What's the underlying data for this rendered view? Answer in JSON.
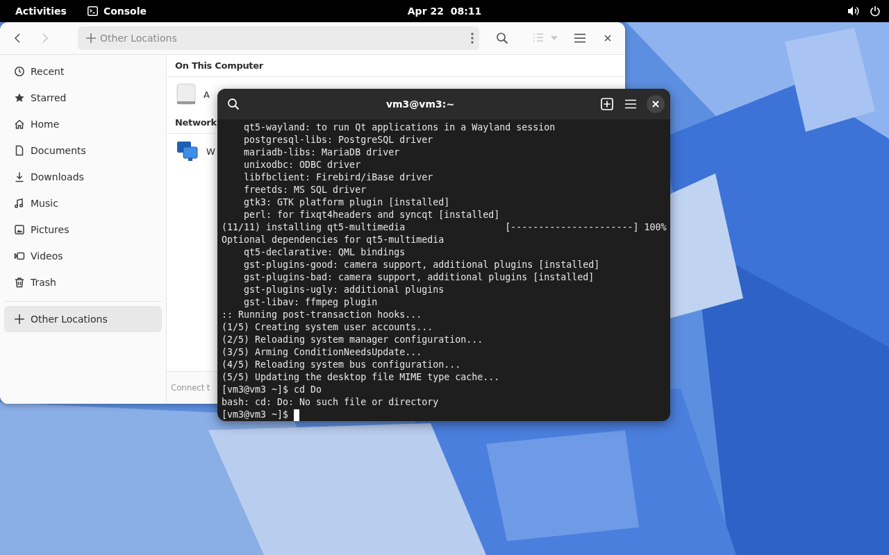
{
  "top_bar": {
    "activities": "Activities",
    "app_name": "Console",
    "clock": "Apr 22  08:11"
  },
  "files_window": {
    "path": "Other Locations",
    "back_disabled": false,
    "forward_disabled": true,
    "sidebar": {
      "items": [
        {
          "label": "Recent",
          "selected": false
        },
        {
          "label": "Starred",
          "selected": false
        },
        {
          "label": "Home",
          "selected": false
        },
        {
          "label": "Documents",
          "selected": false
        },
        {
          "label": "Downloads",
          "selected": false
        },
        {
          "label": "Music",
          "selected": false
        },
        {
          "label": "Pictures",
          "selected": false
        },
        {
          "label": "Videos",
          "selected": false
        },
        {
          "label": "Trash",
          "selected": false
        }
      ],
      "other": {
        "label": "Other Locations",
        "selected": true
      }
    },
    "sections": [
      {
        "heading": "On This Computer",
        "items": [
          {
            "kind": "disk",
            "label": "A"
          }
        ]
      },
      {
        "heading": "Network",
        "items": [
          {
            "kind": "network",
            "label": "W"
          }
        ]
      }
    ],
    "connect_label": "Connect t"
  },
  "terminal": {
    "title": "vm3@vm3:~",
    "lines": [
      "    qt5-wayland: to run Qt applications in a Wayland session",
      "    postgresql-libs: PostgreSQL driver",
      "    mariadb-libs: MariaDB driver",
      "    unixodbc: ODBC driver",
      "    libfbclient: Firebird/iBase driver",
      "    freetds: MS SQL driver",
      "    gtk3: GTK platform plugin [installed]",
      "    perl: for fixqt4headers and syncqt [installed]",
      "(11/11) installing qt5-multimedia                  [----------------------] 100%",
      "Optional dependencies for qt5-multimedia",
      "    qt5-declarative: QML bindings",
      "    gst-plugins-good: camera support, additional plugins [installed]",
      "    gst-plugins-bad: camera support, additional plugins [installed]",
      "    gst-plugins-ugly: additional plugins",
      "    gst-libav: ffmpeg plugin",
      ":: Running post-transaction hooks...",
      "(1/5) Creating system user accounts...",
      "(2/5) Reloading system manager configuration...",
      "(3/5) Arming ConditionNeedsUpdate...",
      "(4/5) Reloading system bus configuration...",
      "(5/5) Updating the desktop file MIME type cache...",
      "[vm3@vm3 ~]$ cd Do",
      "bash: cd: Do: No such file or directory"
    ],
    "prompt": "[vm3@vm3 ~]$ "
  }
}
